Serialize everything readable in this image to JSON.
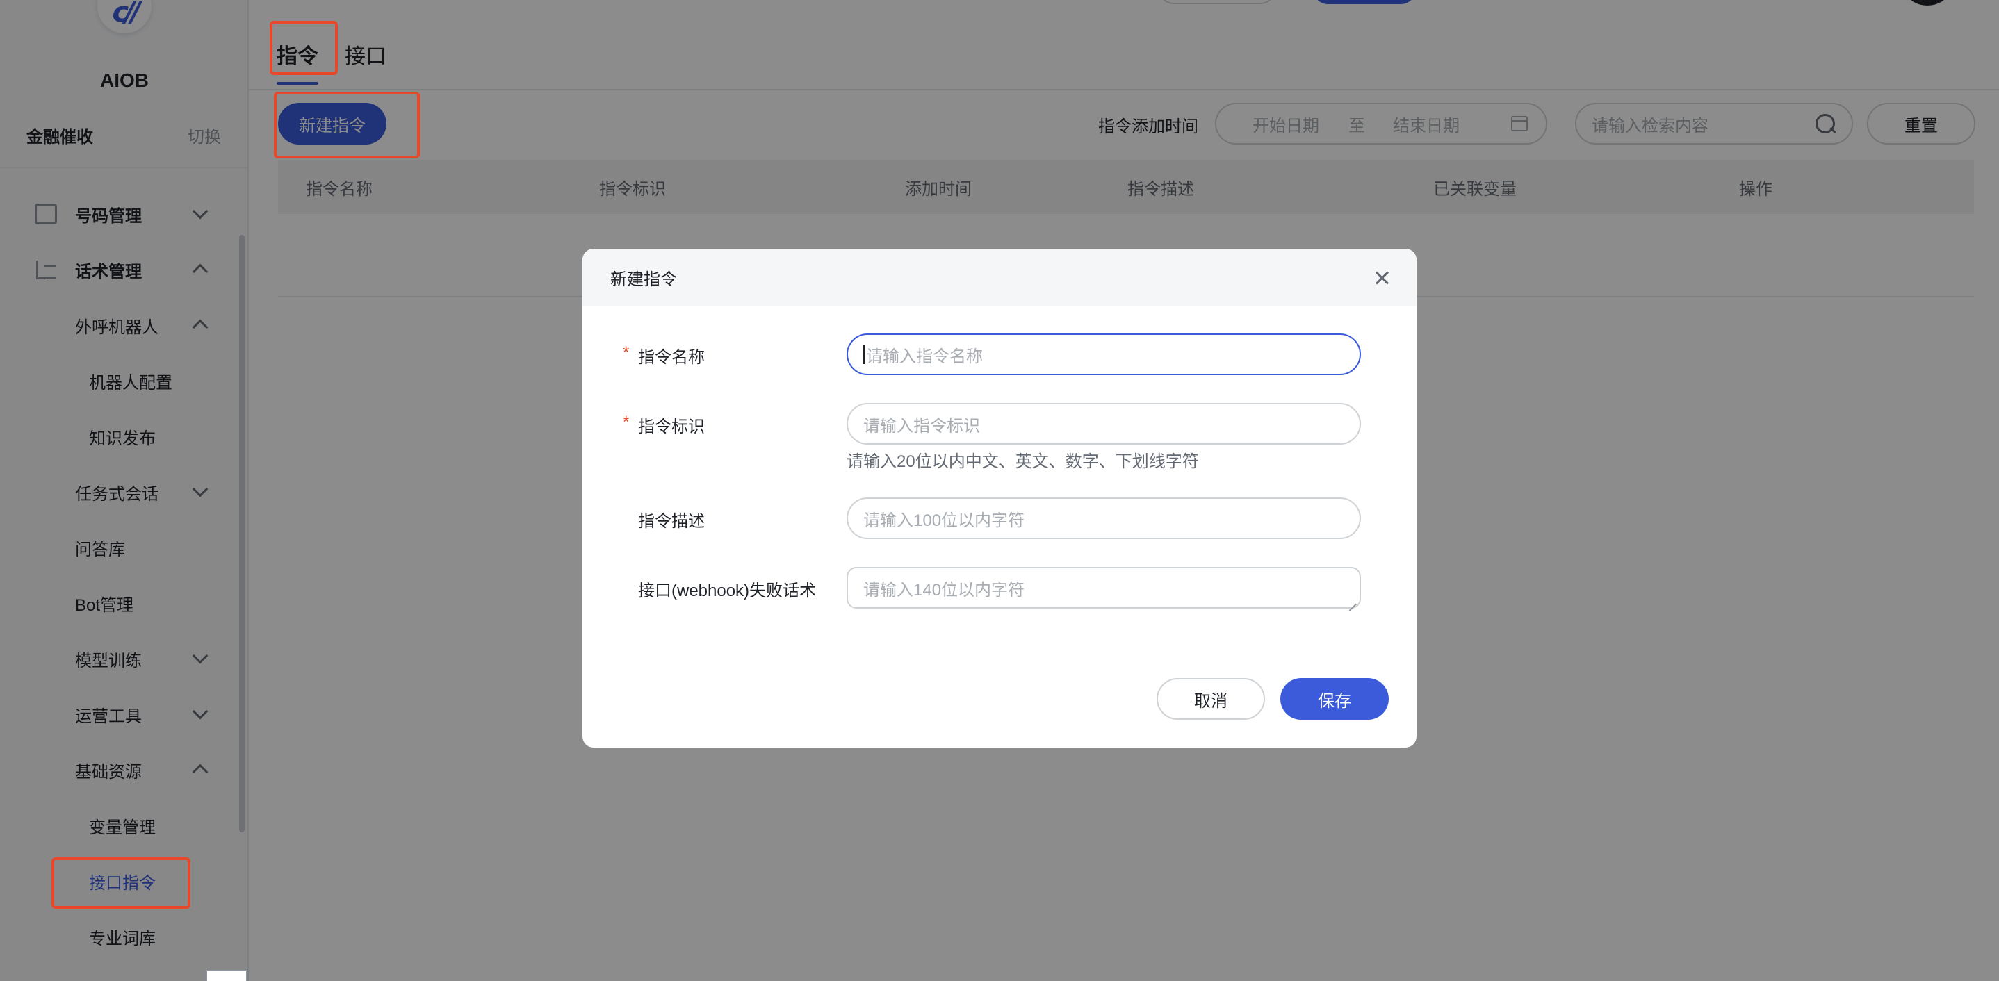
{
  "sidebar": {
    "app_name": "AIOB",
    "logo_text": "c//",
    "tenant_name": "金融催收",
    "tenant_switch": "切换",
    "menu": [
      {
        "label": "号码管理"
      },
      {
        "label": "话术管理"
      },
      {
        "label": "外呼机器人"
      },
      {
        "label": "机器人配置"
      },
      {
        "label": "知识发布"
      },
      {
        "label": "任务式会话"
      },
      {
        "label": "问答库"
      },
      {
        "label": "Bot管理"
      },
      {
        "label": "模型训练"
      },
      {
        "label": "运营工具"
      },
      {
        "label": "基础资源"
      },
      {
        "label": "变量管理"
      },
      {
        "label": "接口指令"
      },
      {
        "label": "专业词库"
      }
    ]
  },
  "main": {
    "tabs": [
      {
        "label": "指令"
      },
      {
        "label": "接口"
      }
    ],
    "new_button": "新建指令",
    "filter": {
      "label": "指令添加时间",
      "start_placeholder": "开始日期",
      "separator": "至",
      "end_placeholder": "结束日期",
      "search_placeholder": "请输入检索内容",
      "reset": "重置"
    },
    "table": {
      "columns": [
        "指令名称",
        "指令标识",
        "添加时间",
        "指令描述",
        "已关联变量",
        "操作"
      ]
    }
  },
  "modal": {
    "title": "新建指令",
    "fields": [
      {
        "label": "指令名称",
        "required": true,
        "placeholder": "请输入指令名称"
      },
      {
        "label": "指令标识",
        "required": true,
        "placeholder": "请输入指令标识",
        "hint": "请输入20位以内中文、英文、数字、下划线字符"
      },
      {
        "label": "指令描述",
        "required": false,
        "placeholder": "请输入100位以内字符"
      },
      {
        "label": "接口(webhook)失败话术",
        "required": false,
        "placeholder": "请输入140位以内字符"
      }
    ],
    "required_mark": "*",
    "cancel": "取消",
    "save": "保存"
  },
  "colors": {
    "primary": "#3b5bdb",
    "highlight": "#e8472a",
    "overlay": "rgba(0,0,0,0.45)"
  },
  "icons": [
    "logo-icon",
    "phone-manage-icon",
    "script-manage-icon",
    "chevron-down-icon",
    "chevron-up-icon",
    "calendar-icon",
    "search-icon",
    "close-icon"
  ]
}
